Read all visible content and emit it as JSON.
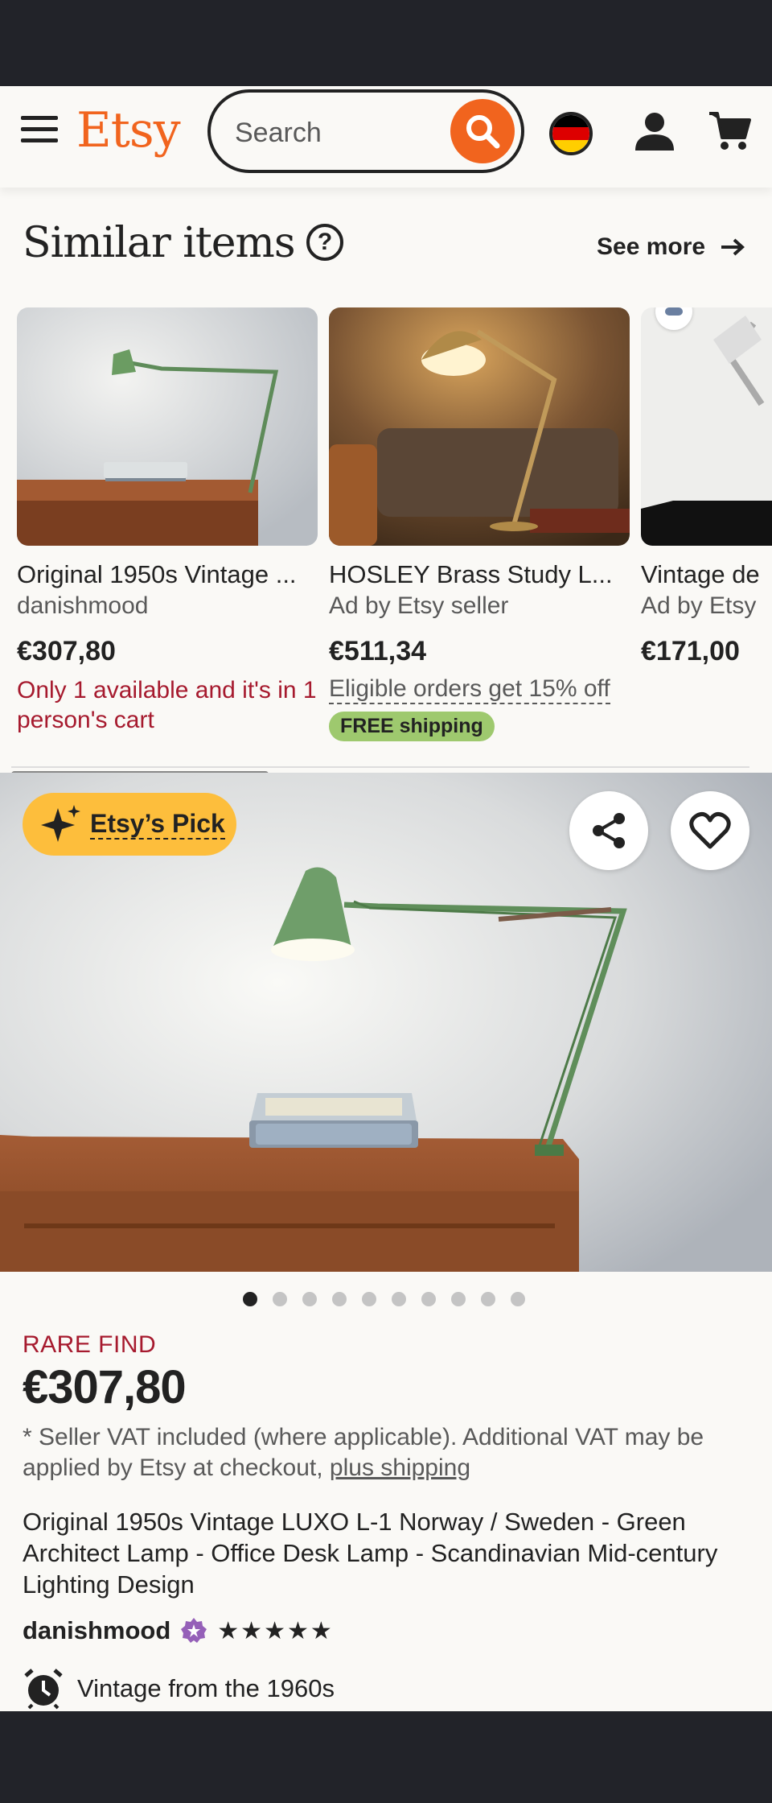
{
  "header": {
    "logo": "Etsy",
    "search_placeholder": "Search"
  },
  "similar": {
    "title": "Similar items",
    "see_more": "See more",
    "items": [
      {
        "title": "Original 1950s Vintage ...",
        "seller": "danishmood",
        "price": "€307,80",
        "note": "Only 1 available and it's in 1 person's cart"
      },
      {
        "title": "HOSLEY Brass Study L...",
        "seller": "Ad by Etsy seller",
        "price": "€511,34",
        "promo": "Eligible orders get 15% off",
        "badge": "FREE shipping"
      },
      {
        "title": "Vintage de",
        "seller": "Ad by Etsy",
        "price": "€171,00"
      }
    ]
  },
  "listing": {
    "pick_label": "Etsy’s Pick",
    "image_count": 10,
    "active_image": 0,
    "rare_label": "RARE FIND",
    "price": "€307,80",
    "vat_text": "* Seller VAT included (where applicable). Additional VAT may be applied by Etsy at checkout,",
    "shipping_link": "plus shipping",
    "title": "Original 1950s Vintage LUXO L-1 Norway / Sweden - Green Architect Lamp - Office Desk Lamp - Scandinavian Mid-century Lighting Design",
    "seller": "danishmood",
    "rating": 5,
    "stars": "★★★★★",
    "vintage": "Vintage from the 1960s"
  },
  "colors": {
    "brand": "#f1641e",
    "rare": "#a61a2e",
    "badge_yellow": "#fdbe3c",
    "free_shipping": "#9ec96e",
    "star_seller": "#9560b8"
  }
}
